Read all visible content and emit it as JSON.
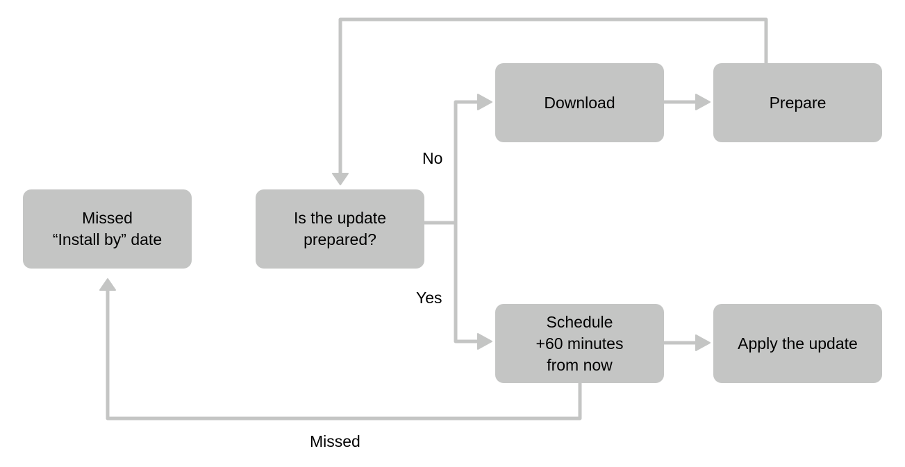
{
  "diagram": {
    "colors": {
      "node_fill": "#c4c5c4",
      "connector": "#c4c5c4",
      "text": "#000000"
    },
    "nodes": {
      "missed_install": {
        "lines": [
          "Missed",
          "“Install by” date"
        ]
      },
      "is_prepared": {
        "lines": [
          "Is the update",
          "prepared?"
        ]
      },
      "download": {
        "lines": [
          "Download"
        ]
      },
      "prepare": {
        "lines": [
          "Prepare"
        ]
      },
      "schedule": {
        "lines": [
          "Schedule",
          "+60 minutes",
          "from now"
        ]
      },
      "apply": {
        "lines": [
          "Apply the update"
        ]
      }
    },
    "edge_labels": {
      "no": "No",
      "yes": "Yes",
      "missed": "Missed"
    },
    "edges": [
      {
        "from": "is_prepared",
        "to": "download",
        "label": "No"
      },
      {
        "from": "download",
        "to": "prepare"
      },
      {
        "from": "prepare",
        "to": "is_prepared"
      },
      {
        "from": "is_prepared",
        "to": "schedule",
        "label": "Yes"
      },
      {
        "from": "schedule",
        "to": "apply"
      },
      {
        "from": "schedule",
        "to": "missed_install",
        "label": "Missed"
      }
    ]
  }
}
